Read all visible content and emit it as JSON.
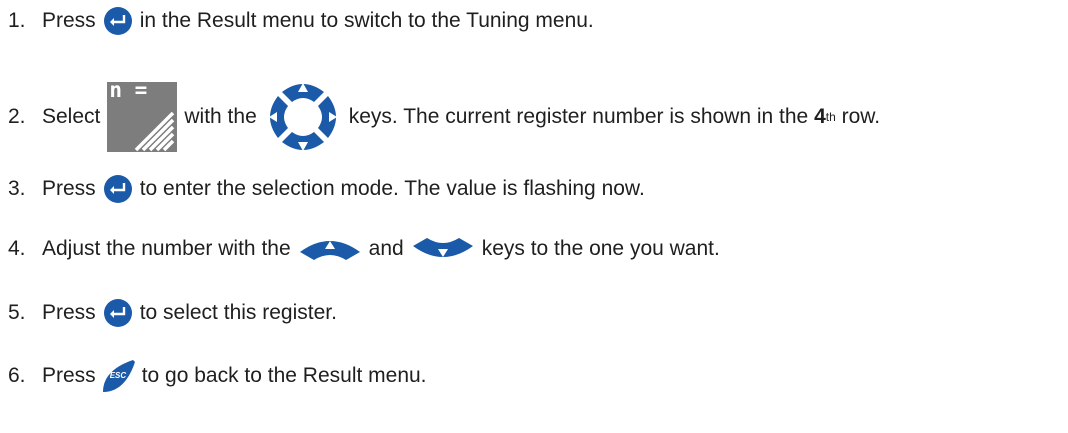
{
  "steps": [
    {
      "number": "1.",
      "parts": [
        "Press",
        "in the Result menu to switch to the Tuning menu."
      ]
    },
    {
      "number": "2.",
      "parts": [
        "Select",
        "with the",
        "keys. The current register number is shown in the",
        "4",
        "th",
        " row."
      ]
    },
    {
      "number": "3.",
      "parts": [
        "Press",
        "to enter the selection mode. The value is flashing now."
      ]
    },
    {
      "number": "4.",
      "parts": [
        "Adjust the number with the",
        "and",
        "keys to the one you want."
      ]
    },
    {
      "number": "5.",
      "parts": [
        "Press",
        "to select this register."
      ]
    },
    {
      "number": "6.",
      "parts": [
        "Press",
        "to go back to the Result menu."
      ]
    }
  ],
  "icons": {
    "enter": "enter-key-icon",
    "tuning_menu": "tuning-menu-icon",
    "tuning_menu_label": "n =",
    "nav": "navigation-keys-icon",
    "up": "up-key-icon",
    "down": "down-key-icon",
    "esc": "esc-key-icon",
    "esc_label": "ESC"
  },
  "colors": {
    "key_blue": "#1a5aa8",
    "menu_gray": "#7d7d7d",
    "text": "#1f1f1f"
  }
}
